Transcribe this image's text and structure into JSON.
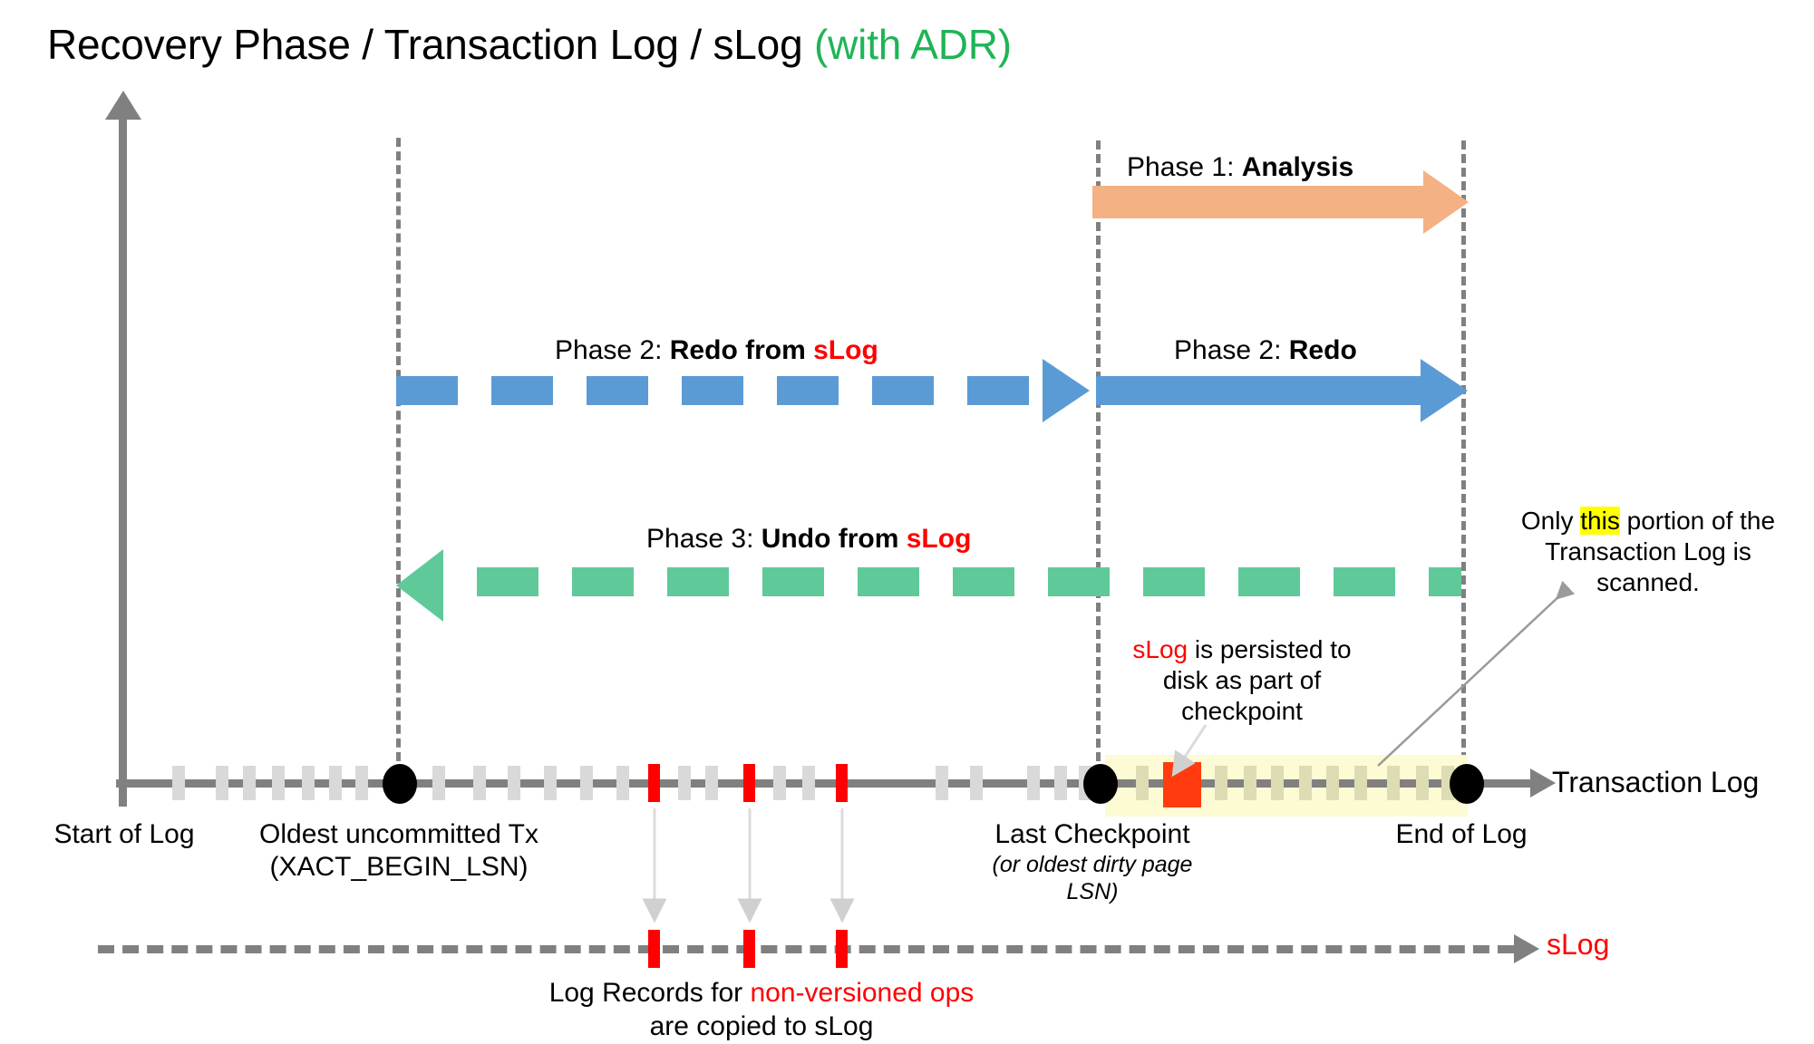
{
  "title": {
    "main": "Recovery Phase / Transaction Log / sLog ",
    "suffix": "(with ADR)"
  },
  "colors": {
    "analysis_arrow": "#f4b183",
    "redo_arrow": "#5b9bd5",
    "undo_arrow": "#5fc99a",
    "slog_red": "#ff0000",
    "highlight_yellow": "#ffff00",
    "scan_band": "#fdfbd4",
    "axis_gray": "#808080",
    "tick_gray": "#d9d9d9",
    "adr_green": "#1fb457",
    "checkpoint_orange": "#ff3b0f"
  },
  "phases": {
    "phase1": {
      "prefix": "Phase 1: ",
      "name": "Analysis"
    },
    "phase2_slog": {
      "prefix": "Phase 2: ",
      "name": "Redo from ",
      "emphasis": "sLog"
    },
    "phase2_redo": {
      "prefix": "Phase 2: ",
      "name": "Redo"
    },
    "phase3_undo": {
      "prefix": "Phase 3: ",
      "name": "Undo from ",
      "emphasis": "sLog"
    }
  },
  "annotations": {
    "checkpoint_note": {
      "line1_em": "sLog",
      "line1_rest": " is persisted to",
      "line2": "disk as part of",
      "line3": "checkpoint"
    },
    "scan_note": {
      "pre": "Only ",
      "hl": "this",
      "post": " portion of the",
      "line2": "Transaction Log is scanned."
    },
    "slog_copy_note": {
      "line1_pre": "Log Records for ",
      "line1_em": "non-versioned ops",
      "line2": "are copied to sLog"
    }
  },
  "axis_labels": {
    "transaction_log": "Transaction Log",
    "slog": "sLog"
  },
  "points": [
    {
      "id": "start-of-log",
      "label": "Start of Log",
      "sub": ""
    },
    {
      "id": "oldest-uncommitted-tx",
      "label": "Oldest uncommitted Tx",
      "sub": "(XACT_BEGIN_LSN)"
    },
    {
      "id": "last-checkpoint",
      "label": "Last Checkpoint",
      "sub": "(or oldest dirty page LSN)"
    },
    {
      "id": "end-of-log",
      "label": "End of Log",
      "sub": ""
    }
  ]
}
